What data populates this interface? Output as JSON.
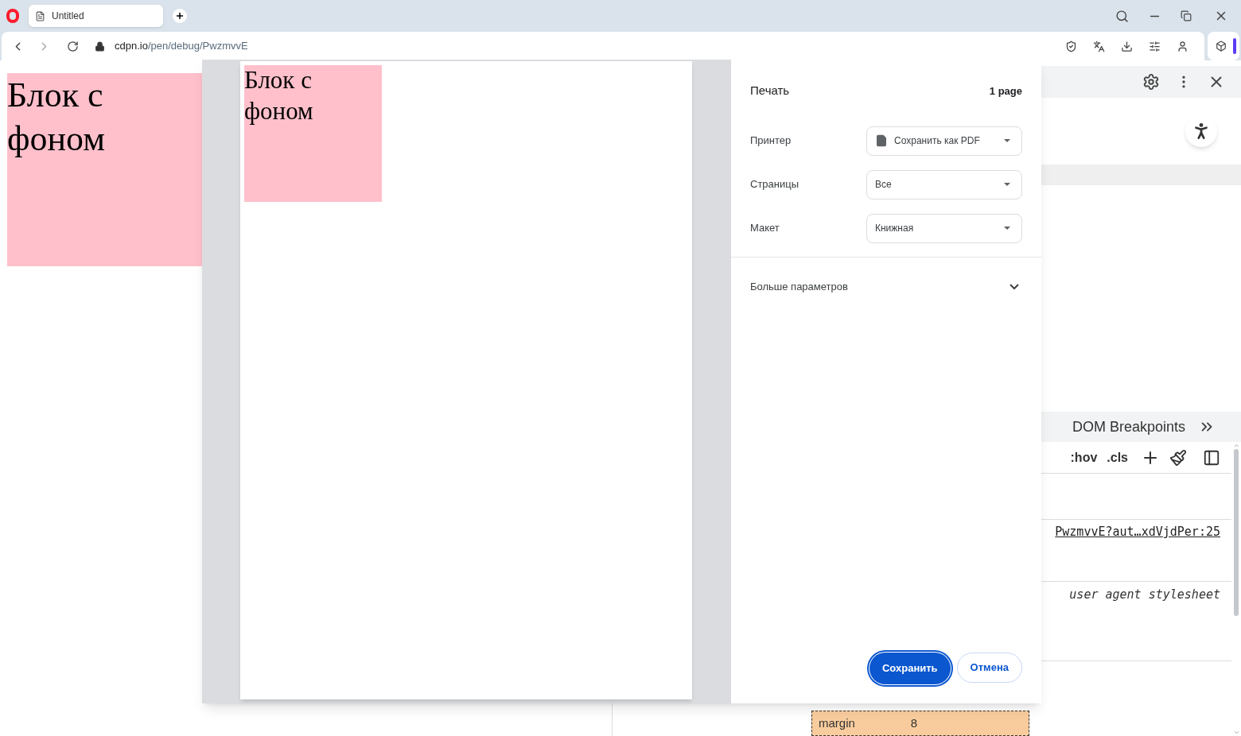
{
  "browser": {
    "tab_title": "Untitled",
    "url_host": "cdpn.io",
    "url_path": "/pen/debug/PwzmvvE"
  },
  "page": {
    "block_text": "Блок с фоном"
  },
  "devtools": {
    "tab": "DOM Breakpoints",
    "style_buttons": [
      ":hov",
      ".cls"
    ],
    "source_link": "PwzmvvE?aut…xdVjdPer:25",
    "origin": "user agent stylesheet",
    "box_model": {
      "label": "margin",
      "value": "8"
    }
  },
  "print_dialog": {
    "title": "Печать",
    "page_count": "1 page",
    "preview": {
      "block_text": "Блок с фоном"
    },
    "fields": [
      {
        "label": "Принтер",
        "value": "Сохранить как PDF",
        "kind": "destination"
      },
      {
        "label": "Страницы",
        "value": "Все",
        "kind": "select"
      },
      {
        "label": "Макет",
        "value": "Книжная",
        "kind": "select"
      }
    ],
    "more": {
      "label": "Больше параметров",
      "expanded": false
    },
    "buttons": [
      {
        "label": "Сохранить",
        "kind": "primary"
      },
      {
        "label": "Отмена",
        "kind": "secondary"
      }
    ]
  }
}
